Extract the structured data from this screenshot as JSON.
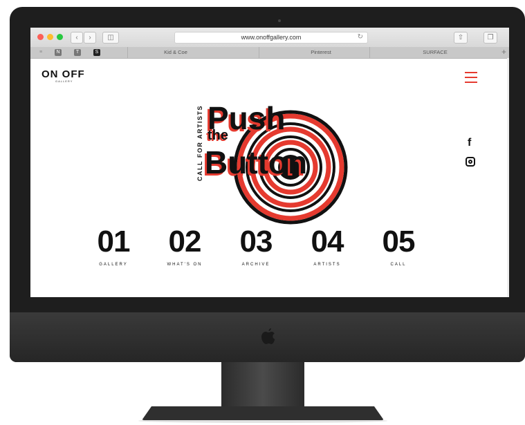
{
  "browser": {
    "url": "www.onoffgallery.com",
    "tabs": [
      {
        "label": "Kid & Coe"
      },
      {
        "label": "Pinterest"
      },
      {
        "label": "SURFACE"
      }
    ],
    "favorites": [
      "N",
      "T",
      "S"
    ]
  },
  "site": {
    "logo": "ON OFF",
    "logo_sub": "GALLERY",
    "hero": {
      "vertical_text": "CALL FOR ARTISTS",
      "word1": "Push",
      "word2": "the",
      "word3": "Button"
    },
    "nav": [
      {
        "number": "01",
        "label": "GALLERY"
      },
      {
        "number": "02",
        "label": "WHAT'S ON"
      },
      {
        "number": "03",
        "label": "ARCHIVE"
      },
      {
        "number": "04",
        "label": "ARTISTS"
      },
      {
        "number": "05",
        "label": "CALL"
      }
    ],
    "social": [
      "facebook-icon",
      "instagram-icon"
    ],
    "colors": {
      "accent": "#e53a2f",
      "text": "#111111"
    }
  }
}
